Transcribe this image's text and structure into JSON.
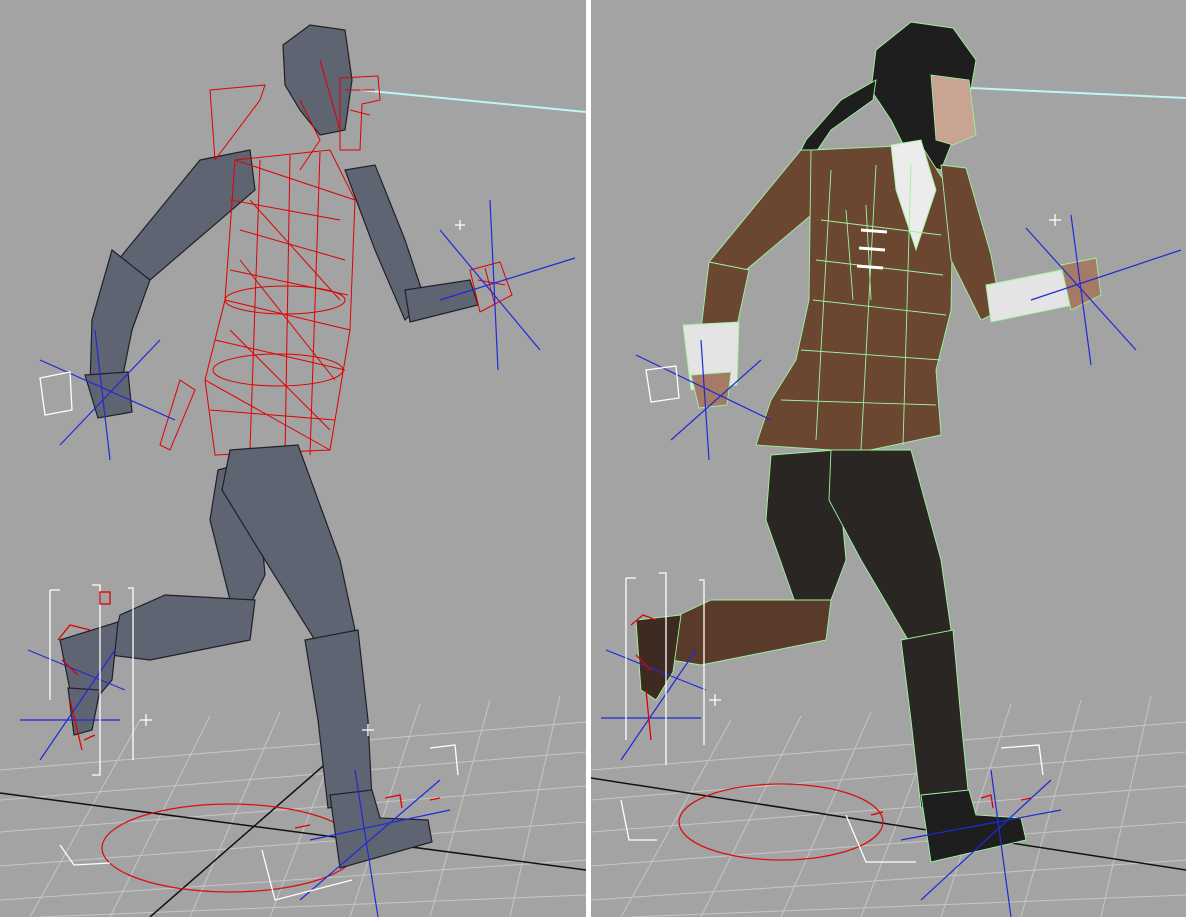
{
  "viewports": [
    {
      "view": "skeleton-rig",
      "shading": "flat-gray",
      "wireframe_color": "#e00000"
    },
    {
      "view": "skinned-character",
      "shading": "textured",
      "wireframe_color": "#9cf59c"
    }
  ],
  "colors": {
    "viewport_background": "#a3a3a3",
    "grid_line": "#c8c8c8",
    "grid_axis": "#000000",
    "bone_fill": "#5f6472",
    "wire_red": "#e00000",
    "gizmo_blue": "#1f2ad8",
    "helper_white": "#ffffff",
    "look_line": "#bff5f5",
    "jacket": "#6b4630",
    "wire_green": "#9cf59c"
  }
}
